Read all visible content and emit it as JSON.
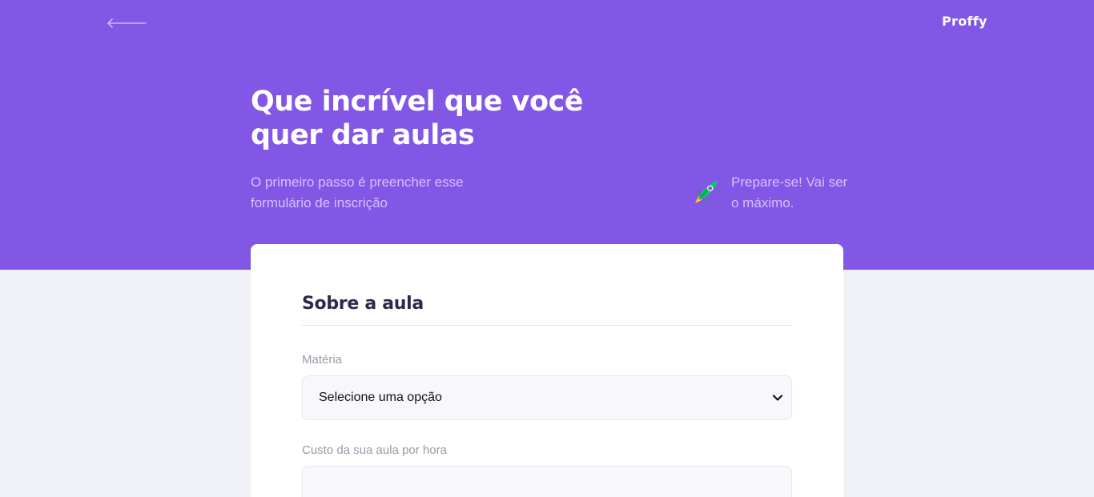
{
  "header": {
    "logo_text": "Proffy",
    "back_icon": "arrow-left-icon"
  },
  "hero": {
    "title": "Que incrível que você quer dar aulas",
    "subtitle": "O primeiro passo é preencher esse formulário de inscrição",
    "tip_icon": "rocket-icon",
    "tip_text": "Prepare-se! Vai ser o máximo."
  },
  "form": {
    "legend": "Sobre a aula",
    "subject": {
      "label": "Matéria",
      "selected": "Selecione uma opção"
    },
    "cost": {
      "label": "Custo da sua aula por hora",
      "value": "",
      "placeholder": ""
    }
  },
  "colors": {
    "primary": "#8257e5",
    "background": "#f0f0f7",
    "title_text": "#32264d",
    "muted_text": "#9c98a6",
    "hero_muted_text": "#d4c2ff",
    "input_background": "#f8f8fc"
  }
}
